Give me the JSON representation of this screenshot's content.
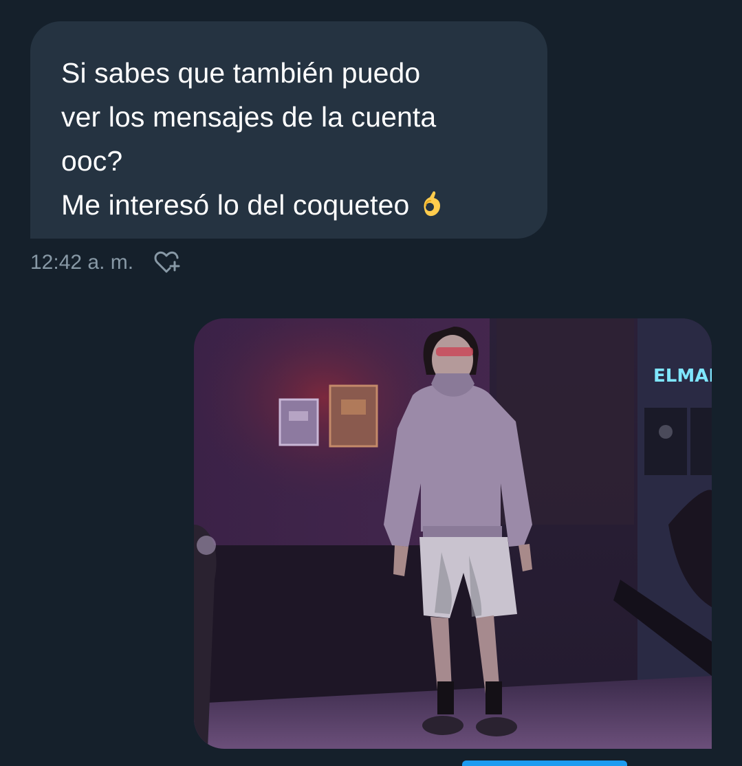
{
  "conversation": {
    "received_message": {
      "lines": [
        "Si sabes que también puedo",
        "ver los mensajes de la cuenta",
        "ooc?",
        "Me interesó lo del coqueteo"
      ],
      "emoji": "ok-hand-emoji",
      "timestamp": "12:42 a. m.",
      "react_icon": "heart-plus-icon"
    },
    "sent_media": {
      "kind": "photo",
      "sign_text": "ELMARI"
    }
  },
  "colors": {
    "background": "#15202b",
    "received_bubble": "#253341",
    "message_text": "#ffffff",
    "meta_text": "#8899a6",
    "accent": "#1d9bf0"
  }
}
